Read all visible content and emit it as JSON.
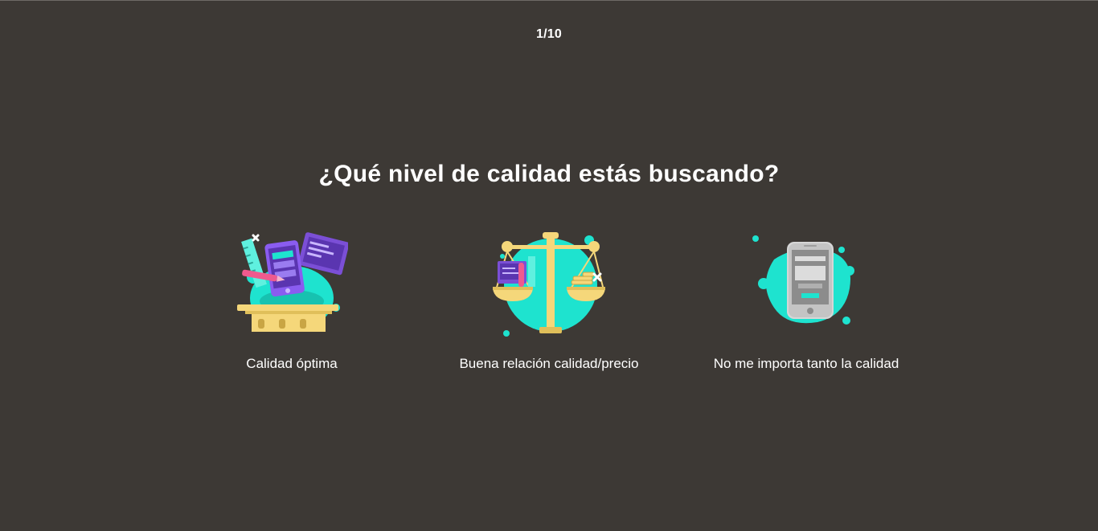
{
  "progress": {
    "text": "1/10"
  },
  "question": {
    "title": "¿Qué nivel de calidad estás buscando?"
  },
  "options": [
    {
      "label": "Calidad óptima",
      "icon": "premium-quality-illustration"
    },
    {
      "label": "Buena relación calidad/precio",
      "icon": "balance-scale-illustration"
    },
    {
      "label": "No me importa tanto la calidad",
      "icon": "basic-phone-illustration"
    }
  ],
  "colors": {
    "background": "#3d3935",
    "text": "#ffffff",
    "accent_teal": "#1ee3cf",
    "purple": "#7b4fd6",
    "yellow": "#f5d77a",
    "pink": "#ef5a8e"
  }
}
